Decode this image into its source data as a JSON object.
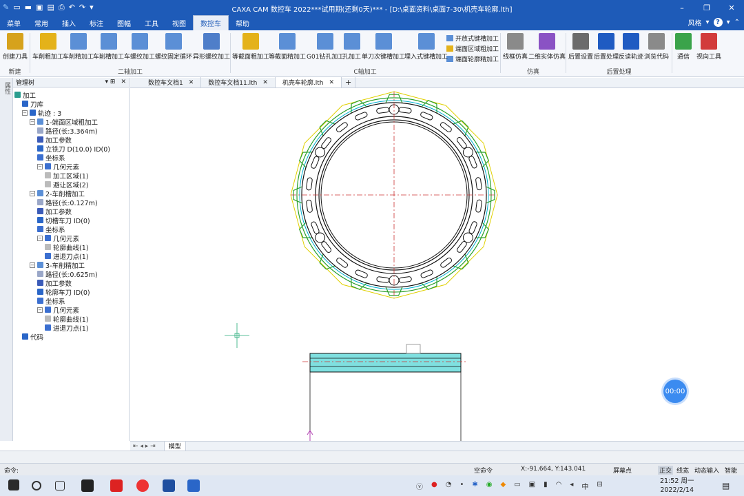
{
  "window": {
    "title": "CAXA CAM 数控车 2022***试用期(还剩0天)*** - [D:\\桌面资料\\桌面7-30\\机壳车轮廓.lth]",
    "minimize": "–",
    "restore": "❐",
    "close": "✕"
  },
  "menu": {
    "items": [
      "菜单",
      "常用",
      "插入",
      "标注",
      "图幅",
      "工具",
      "视图",
      "数控车",
      "帮助"
    ],
    "active": "数控车",
    "style_label": "风格",
    "help_icon": "?"
  },
  "ribbon": {
    "buttons": [
      {
        "label": "创建刀具",
        "icon": "tool-create-icon",
        "color": "#d6a21c"
      },
      {
        "label": "车削粗加工",
        "icon": "rough-turn-icon",
        "color": "#e4b21a"
      },
      {
        "label": "车削精加工",
        "icon": "finish-turn-icon",
        "color": "#5b8fd6"
      },
      {
        "label": "车削槽加工",
        "icon": "groove-icon",
        "color": "#5b8fd6"
      },
      {
        "label": "车螺纹加工",
        "icon": "thread-icon",
        "color": "#5b8fd6"
      },
      {
        "label": "螺纹固定循环",
        "icon": "thread-cycle-icon",
        "color": "#5b8fd6"
      },
      {
        "label": "异形螺纹加工",
        "icon": "special-thread-icon",
        "color": "#4f7ec9"
      },
      {
        "label": "等截面粗加工",
        "icon": "section-rough-icon",
        "color": "#e4b21a"
      },
      {
        "label": "等截面精加工",
        "icon": "section-finish-icon",
        "color": "#5b8fd6"
      },
      {
        "label": "G01钻孔加工",
        "icon": "drill-g01-icon",
        "color": "#5b8fd6"
      },
      {
        "label": "孔加工",
        "icon": "hole-icon",
        "color": "#5b8fd6"
      },
      {
        "label": "单刀次键槽加工",
        "icon": "single-keyway-icon",
        "color": "#5b8fd6"
      },
      {
        "label": "埋入式键槽加工",
        "icon": "embedded-keyway-icon",
        "color": "#5b8fd6"
      },
      {
        "label": "线框仿真",
        "icon": "wire-sim-icon",
        "color": "#8a8a8a"
      },
      {
        "label": "二维实体仿真",
        "icon": "solid-sim-icon",
        "color": "#8a52c4"
      },
      {
        "label": "后置设置",
        "icon": "post-setting-icon",
        "color": "#6b6b6b"
      },
      {
        "label": "后置处理",
        "icon": "post-process-icon",
        "color": "#1f5bc2"
      },
      {
        "label": "反读轨迹",
        "icon": "reverse-read-icon",
        "color": "#1f5bc2"
      },
      {
        "label": "浏览代码",
        "icon": "browse-code-icon",
        "color": "#8a8a8a"
      },
      {
        "label": "通信",
        "icon": "communication-icon",
        "color": "#3aa34a"
      },
      {
        "label": "视向工具",
        "icon": "view-tool-icon",
        "color": "#d23b3b"
      }
    ],
    "small_buttons": [
      "开放式键槽加工",
      "端面区域粗加工",
      "端面轮廓精加工"
    ],
    "groups": [
      "新建",
      "二轴加工",
      "C轴加工",
      "仿真",
      "后置处理"
    ]
  },
  "left_strip": {
    "label": "属性"
  },
  "panel": {
    "title": "管理树",
    "pin": "▾ ⊞",
    "close": "✕"
  },
  "tree": [
    {
      "label": "加工",
      "level": 0,
      "icon": "process-icon",
      "toggle": ""
    },
    {
      "label": "刀库",
      "level": 1,
      "icon": "tool-library-icon",
      "toggle": ""
    },
    {
      "label": "轨迹 : 3",
      "level": 1,
      "icon": "trajectory-icon",
      "toggle": "−"
    },
    {
      "label": "1-端面区域粗加工",
      "level": 2,
      "icon": "operation-icon",
      "toggle": "−"
    },
    {
      "label": "路径(长:3.364m)",
      "level": 3,
      "icon": "path-icon",
      "toggle": ""
    },
    {
      "label": "加工参数",
      "level": 3,
      "icon": "params-icon",
      "toggle": ""
    },
    {
      "label": "立铣刀 D(10.0) ID(0)",
      "level": 3,
      "icon": "tool-icon",
      "toggle": ""
    },
    {
      "label": "坐标系",
      "level": 3,
      "icon": "coordinate-icon",
      "toggle": ""
    },
    {
      "label": "几何元素",
      "level": 3,
      "icon": "geometry-icon",
      "toggle": "−"
    },
    {
      "label": "加工区域(1)",
      "level": 4,
      "icon": "region-icon",
      "toggle": ""
    },
    {
      "label": "避让区域(2)",
      "level": 4,
      "icon": "region-icon",
      "toggle": ""
    },
    {
      "label": "2-车削槽加工",
      "level": 2,
      "icon": "operation-icon",
      "toggle": "−"
    },
    {
      "label": "路径(长:0.127m)",
      "level": 3,
      "icon": "path-icon",
      "toggle": ""
    },
    {
      "label": "加工参数",
      "level": 3,
      "icon": "params-icon",
      "toggle": ""
    },
    {
      "label": "切槽车刀 ID(0)",
      "level": 3,
      "icon": "tool-icon",
      "toggle": ""
    },
    {
      "label": "坐标系",
      "level": 3,
      "icon": "coordinate-icon",
      "toggle": ""
    },
    {
      "label": "几何元素",
      "level": 3,
      "icon": "geometry-icon",
      "toggle": "−"
    },
    {
      "label": "轮廓曲线(1)",
      "level": 4,
      "icon": "curve-icon",
      "toggle": ""
    },
    {
      "label": "进退刀点(1)",
      "level": 4,
      "icon": "point-icon",
      "toggle": ""
    },
    {
      "label": "3-车削精加工",
      "level": 2,
      "icon": "operation-icon",
      "toggle": "−"
    },
    {
      "label": "路径(长:0.625m)",
      "level": 3,
      "icon": "path-icon",
      "toggle": ""
    },
    {
      "label": "加工参数",
      "level": 3,
      "icon": "params-icon",
      "toggle": ""
    },
    {
      "label": "轮廓车刀 ID(0)",
      "level": 3,
      "icon": "tool-icon",
      "toggle": ""
    },
    {
      "label": "坐标系",
      "level": 3,
      "icon": "coordinate-icon",
      "toggle": ""
    },
    {
      "label": "几何元素",
      "level": 3,
      "icon": "geometry-icon",
      "toggle": "−"
    },
    {
      "label": "轮廓曲线(1)",
      "level": 4,
      "icon": "curve-icon",
      "toggle": ""
    },
    {
      "label": "进退刀点(1)",
      "level": 4,
      "icon": "point-icon",
      "toggle": ""
    },
    {
      "label": "代码",
      "level": 1,
      "icon": "code-icon",
      "toggle": ""
    }
  ],
  "doc_tabs": [
    {
      "label": "数控车文档1",
      "active": false
    },
    {
      "label": "数控车文档11.lth",
      "active": false
    },
    {
      "label": "机壳车轮廓.lth",
      "active": true
    }
  ],
  "add_tab": "+",
  "bottom_tabs": {
    "nav": "⇤ ◂ ▸ ⇥",
    "model": "模型"
  },
  "status": {
    "command_label": "命令:",
    "empty_command": "空命令",
    "coords": "X:-91.664, Y:143.041",
    "snap": "屏幕点",
    "modes": [
      "正交",
      "线宽",
      "动态输入",
      "智能"
    ]
  },
  "timer": "00:00",
  "taskbar": {
    "time": "21:52 周一",
    "date": "2022/2/14",
    "ime": "中"
  }
}
